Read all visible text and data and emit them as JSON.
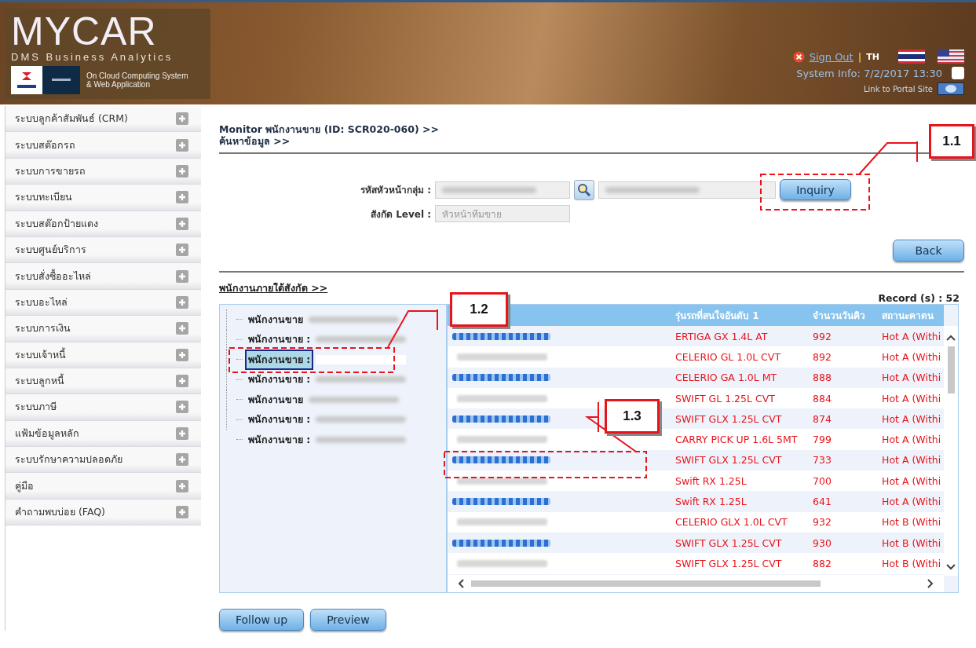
{
  "header": {
    "logo": "MYCAR",
    "tagline": "DMS Business Analytics",
    "brand_note": "On Cloud Computing System\n& Web Application",
    "sign_out": "Sign Out",
    "separator": "|",
    "language": "TH",
    "system_info": "System Info: 7/2/2017 13:30",
    "option_checked": false,
    "portal_link": "Link to Portal Site"
  },
  "sidebar": {
    "items": [
      {
        "label": "ระบบลูกค้าสัมพันธ์ (CRM)",
        "expanded": false
      },
      {
        "label": "ระบบสต๊อกรถ",
        "expanded": false
      },
      {
        "label": "ระบบการขายรถ",
        "expanded": false
      },
      {
        "label": "ระบบทะเบียน",
        "expanded": false
      },
      {
        "label": "ระบบสต๊อกป้ายแดง",
        "expanded": false
      },
      {
        "label": "ระบบศูนย์บริการ",
        "expanded": false
      },
      {
        "label": "ระบบสั่งซื้ออะไหล่",
        "expanded": false
      },
      {
        "label": "ระบบอะไหล่",
        "expanded": false
      },
      {
        "label": "ระบบการเงิน",
        "expanded": false
      },
      {
        "label": "ระบบเจ้าหนี้",
        "expanded": false
      },
      {
        "label": "ระบบลูกหนี้",
        "expanded": false
      },
      {
        "label": "ระบบภาษี",
        "expanded": false
      },
      {
        "label": "แฟ้มข้อมูลหลัก",
        "expanded": false
      },
      {
        "label": "ระบบรักษาความปลอดภัย",
        "expanded": false
      },
      {
        "label": "คู่มือ",
        "expanded": false
      },
      {
        "label": "คำถามพบบ่อย (FAQ)",
        "expanded": false
      }
    ]
  },
  "breadcrumb": [
    "Monitor พนักงานขาย (ID: SCR020-060) >>",
    "ค้นหาข้อมูล >>"
  ],
  "form": {
    "group_head_label": "รหัสหัวหน้ากลุ่ม :",
    "level_label": "สังกัด Level :",
    "level_value": "หัวหน้าทีมขาย",
    "inquiry": "Inquiry",
    "back": "Back"
  },
  "section_title": "พนักงานภายใต้สังกัด >>",
  "record_count": "Record (s) : 52",
  "tree": [
    {
      "label": "พนักงานขาย",
      "selected": false
    },
    {
      "label": "พนักงานขาย :",
      "selected": false
    },
    {
      "label": "พนักงานขาย :",
      "selected": true
    },
    {
      "label": "พนักงานขาย :",
      "selected": false
    },
    {
      "label": "พนักงานขาย",
      "selected": false
    },
    {
      "label": "พนักงานขาย :",
      "selected": false
    },
    {
      "label": "พนักงานขาย :",
      "selected": false
    }
  ],
  "table": {
    "columns": [
      "รุ่นรถที่สนใจอันดับ 1",
      "จำนวนวันคิว",
      "สถานะคาดน"
    ],
    "rows": [
      {
        "model": "ERTIGA GX 1.4L AT",
        "queue": "992",
        "status": "Hot A (Withi"
      },
      {
        "model": "CELERIO GL 1.0L CVT",
        "queue": "892",
        "status": "Hot A (Withi"
      },
      {
        "model": "CELERIO GA 1.0L MT",
        "queue": "888",
        "status": "Hot A (Withi"
      },
      {
        "model": "SWIFT GL 1.25L CVT",
        "queue": "884",
        "status": "Hot A (Withi"
      },
      {
        "model": "SWIFT GLX 1.25L CVT",
        "queue": "874",
        "status": "Hot A (Withi"
      },
      {
        "model": "CARRY PICK UP 1.6L 5MT",
        "queue": "799",
        "status": "Hot A (Withi"
      },
      {
        "model": "SWIFT GLX 1.25L CVT",
        "queue": "733",
        "status": "Hot A (Withi"
      },
      {
        "model": "Swift RX 1.25L",
        "queue": "700",
        "status": "Hot A (Withi"
      },
      {
        "model": "Swift RX 1.25L",
        "queue": "641",
        "status": "Hot A (Withi"
      },
      {
        "model": "CELERIO GLX 1.0L CVT",
        "queue": "932",
        "status": "Hot B (Withi"
      },
      {
        "model": "SWIFT GLX 1.25L CVT",
        "queue": "930",
        "status": "Hot B (Withi"
      },
      {
        "model": "SWIFT GLX 1.25L CVT",
        "queue": "882",
        "status": "Hot B (Withi"
      }
    ]
  },
  "buttons": [
    "Follow up",
    "Preview"
  ],
  "callouts": [
    {
      "label": "1.1"
    },
    {
      "label": "1.2"
    },
    {
      "label": "1.3"
    }
  ]
}
